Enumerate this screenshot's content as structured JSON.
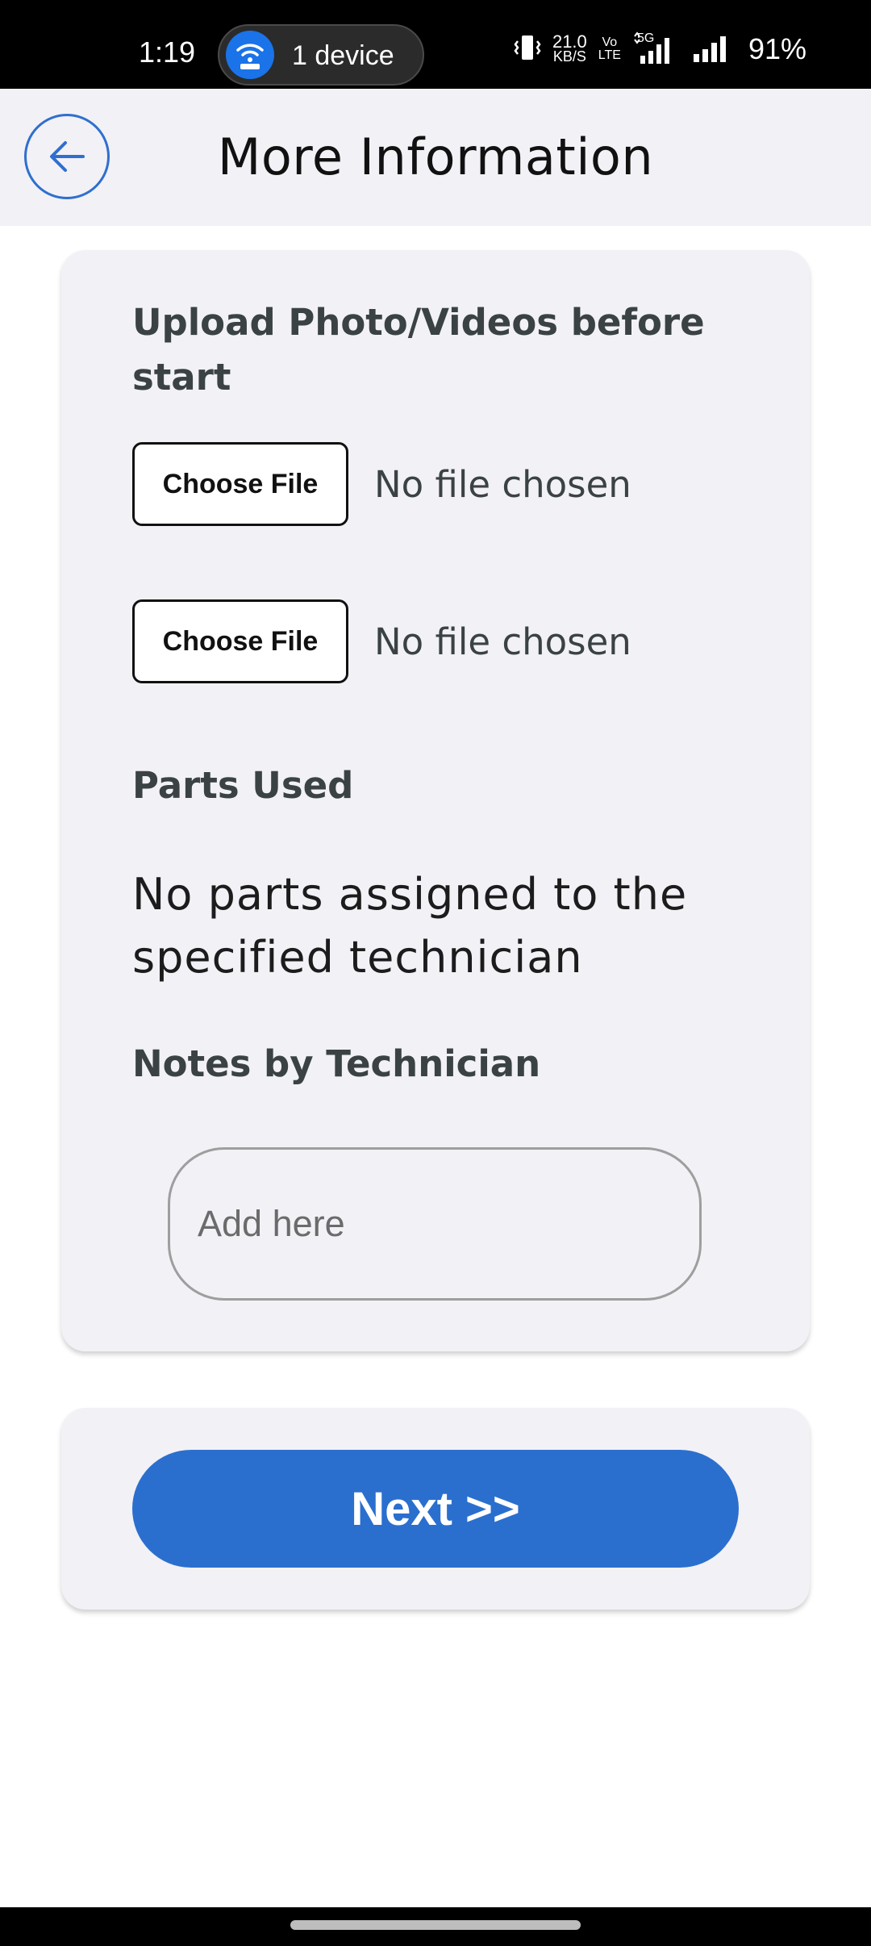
{
  "status_bar": {
    "time": "1:19",
    "device_pill_label": "1 device",
    "net_speed_value": "21.0",
    "net_speed_unit": "KB/S",
    "volte_top": "Vo",
    "volte_bottom": "LTE",
    "network_type": "5G",
    "battery": "91%",
    "icons": [
      "wifi-hotspot-icon",
      "vibrate-icon",
      "signal-5g-icon",
      "signal-icon"
    ]
  },
  "app_bar": {
    "title": "More Information",
    "back_icon": "arrow-left-icon",
    "accent_color": "#2f6fce"
  },
  "upload_section": {
    "heading": "Upload Photo/Videos before start",
    "files": [
      {
        "button_label": "Choose File",
        "status": "No file chosen"
      },
      {
        "button_label": "Choose File",
        "status": "No file chosen"
      }
    ]
  },
  "parts_section": {
    "heading": "Parts Used",
    "message": "No parts assigned to the specified technician"
  },
  "notes_section": {
    "heading": "Notes by Technician",
    "placeholder": "Add here",
    "value": ""
  },
  "actions": {
    "next_label": "Next >>",
    "next_color": "#2b6fce"
  }
}
